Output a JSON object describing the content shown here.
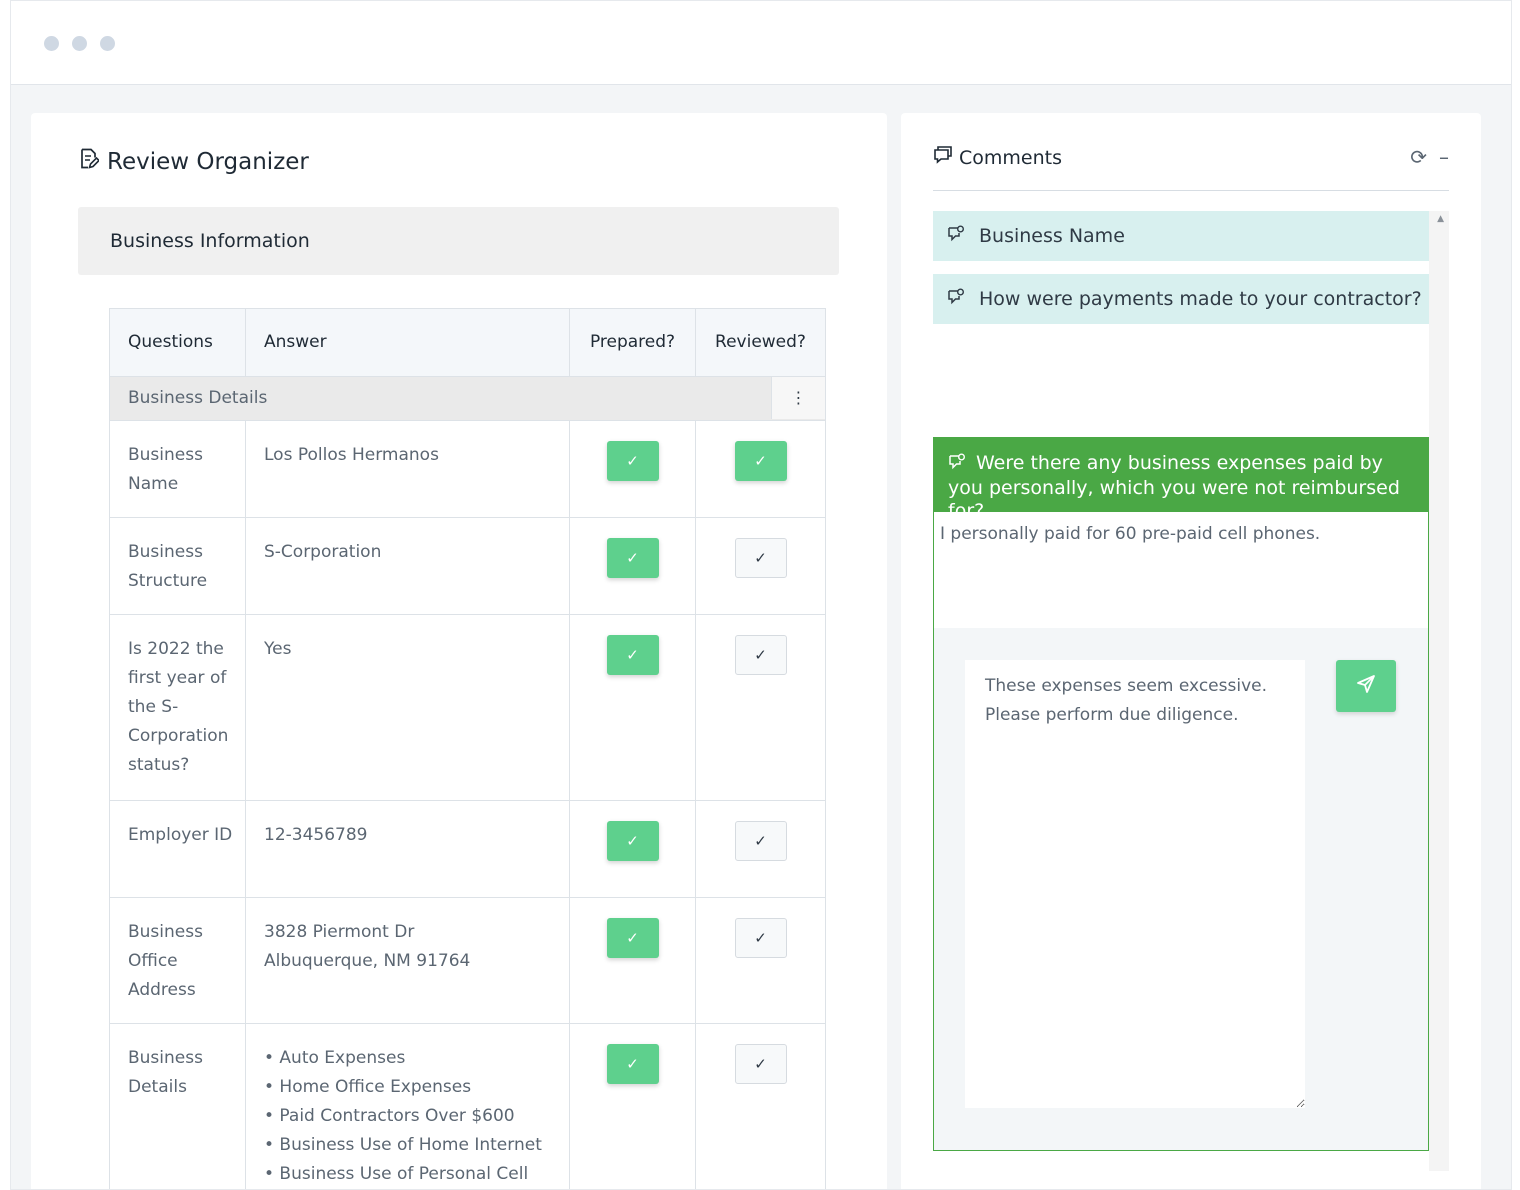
{
  "page": {
    "title": "Review Organizer"
  },
  "section": {
    "title": "Business Information"
  },
  "table": {
    "headers": {
      "question": "Questions",
      "answer": "Answer",
      "prepared": "Prepared?",
      "reviewed": "Reviewed?"
    },
    "group_label": "Business Details",
    "kebab_glyph": "⋮",
    "check_glyph": "✓",
    "rows": [
      {
        "question": "Business Name",
        "answer": "Los Pollos Hermanos",
        "prepared": true,
        "reviewed": true
      },
      {
        "question": "Business Structure",
        "answer": "S-Corporation",
        "prepared": true,
        "reviewed": false
      },
      {
        "question": "Is 2022 the first year of the S-Corporation status?",
        "answer": "Yes",
        "prepared": true,
        "reviewed": false
      },
      {
        "question": "Employer ID",
        "answer": "12-3456789",
        "prepared": true,
        "reviewed": false
      },
      {
        "question": "Business Office Address",
        "answer_lines": [
          "3828 Piermont Dr",
          "Albuquerque, NM 91764"
        ],
        "prepared": true,
        "reviewed": false
      },
      {
        "question": "Business Details",
        "answer_list": [
          "• Auto Expenses",
          "• Home Office Expenses",
          "• Paid Contractors Over $600",
          "• Business Use of Home Internet",
          "• Business Use of Personal Cell"
        ],
        "prepared": true,
        "reviewed": false
      }
    ]
  },
  "comments": {
    "title": "Comments",
    "refresh_glyph": "⟳",
    "minimize_glyph": "–",
    "threads": [
      {
        "title": "Business Name"
      },
      {
        "title": "How were payments made to your contractor?"
      }
    ],
    "open_thread": {
      "title": "Were there any business expenses paid by you personally, which you were not reimbursed for?",
      "answer": "I personally paid for 60 pre-paid cell phones.",
      "reply_text": "These expenses seem excessive.\nPlease perform due diligence."
    }
  },
  "colors": {
    "accent_green": "#5ed08d",
    "thread_green": "#4aa845",
    "thread_bg": "#d8f0ef"
  }
}
